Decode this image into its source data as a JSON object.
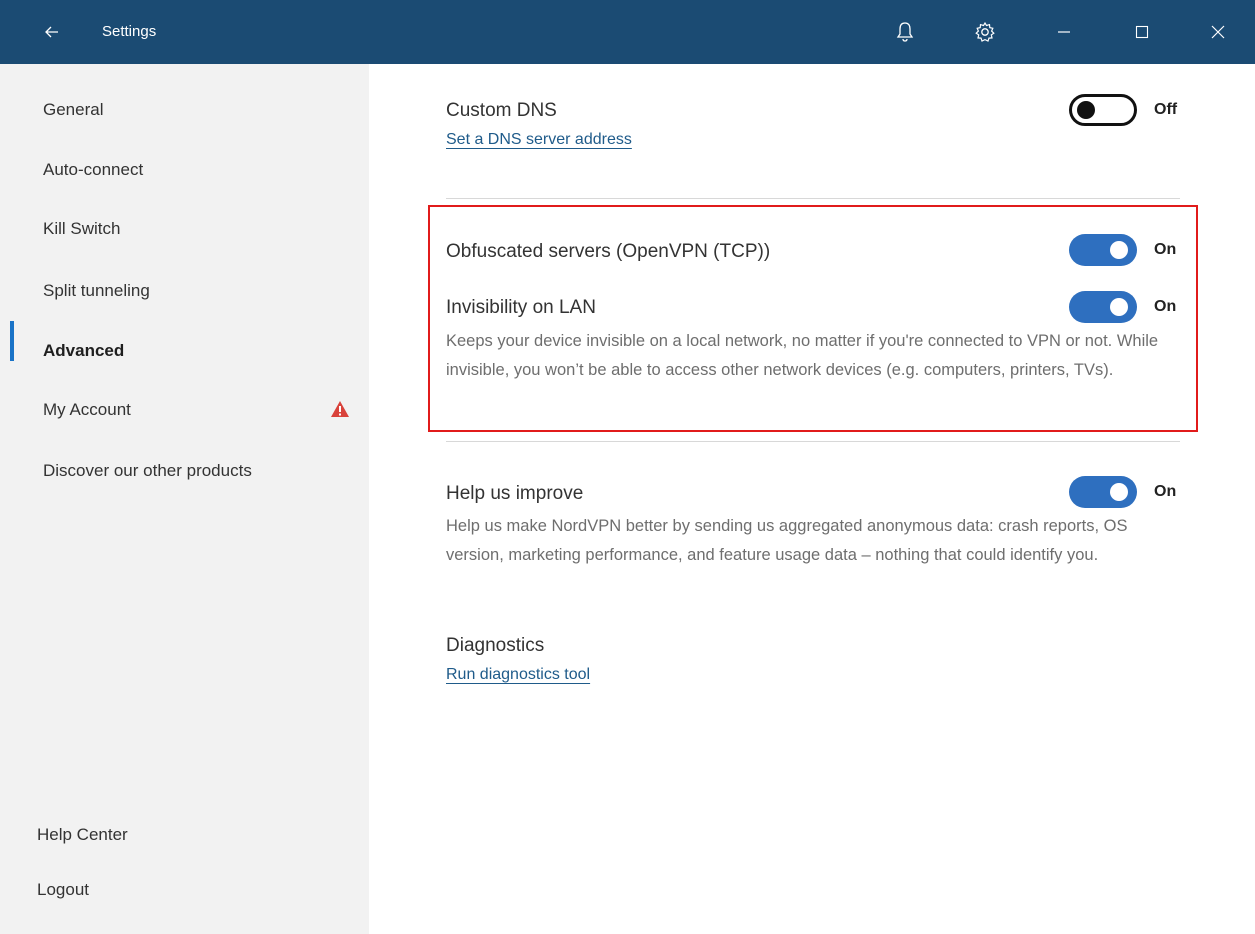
{
  "titlebar": {
    "title": "Settings",
    "back_icon": "arrow-left-icon",
    "bell_icon": "bell-icon",
    "gear_icon": "gear-icon",
    "minimize_icon": "minimize-icon",
    "maximize_icon": "maximize-icon",
    "close_icon": "close-icon"
  },
  "sidebar": {
    "items": [
      {
        "label": "General"
      },
      {
        "label": "Auto-connect"
      },
      {
        "label": "Kill Switch"
      },
      {
        "label": "Split tunneling"
      },
      {
        "label": "Advanced",
        "active": true
      },
      {
        "label": "My Account",
        "icon": "warning-icon"
      },
      {
        "label": "Discover our other products"
      }
    ],
    "footer": [
      {
        "label": "Help Center"
      },
      {
        "label": "Logout"
      }
    ]
  },
  "main": {
    "custom_dns": {
      "title": "Custom DNS",
      "link": "Set a DNS server address",
      "toggle_state": "Off"
    },
    "obfuscated": {
      "title": "Obfuscated servers (OpenVPN (TCP))",
      "toggle_state": "On"
    },
    "invisibility": {
      "title": "Invisibility on LAN",
      "toggle_state": "On",
      "description": "Keeps your device invisible on a local network, no matter if you're connected to VPN or not. While invisible, you won’t be able to access other network devices (e.g. computers, printers, TVs)."
    },
    "help_improve": {
      "title": "Help us improve",
      "toggle_state": "On",
      "description": "Help us make NordVPN better by sending us aggregated anonymous data: crash reports, OS version, marketing performance, and feature usage data – nothing that could identify you."
    },
    "diagnostics": {
      "title": "Diagnostics",
      "link": "Run diagnostics tool"
    }
  },
  "colors": {
    "titlebar": "#1b4b73",
    "sidebar": "#f2f2f2",
    "accent": "#1a73c7",
    "toggle_on": "#2e6fbf",
    "highlight": "#e11b1b",
    "warning": "#d9423b"
  }
}
